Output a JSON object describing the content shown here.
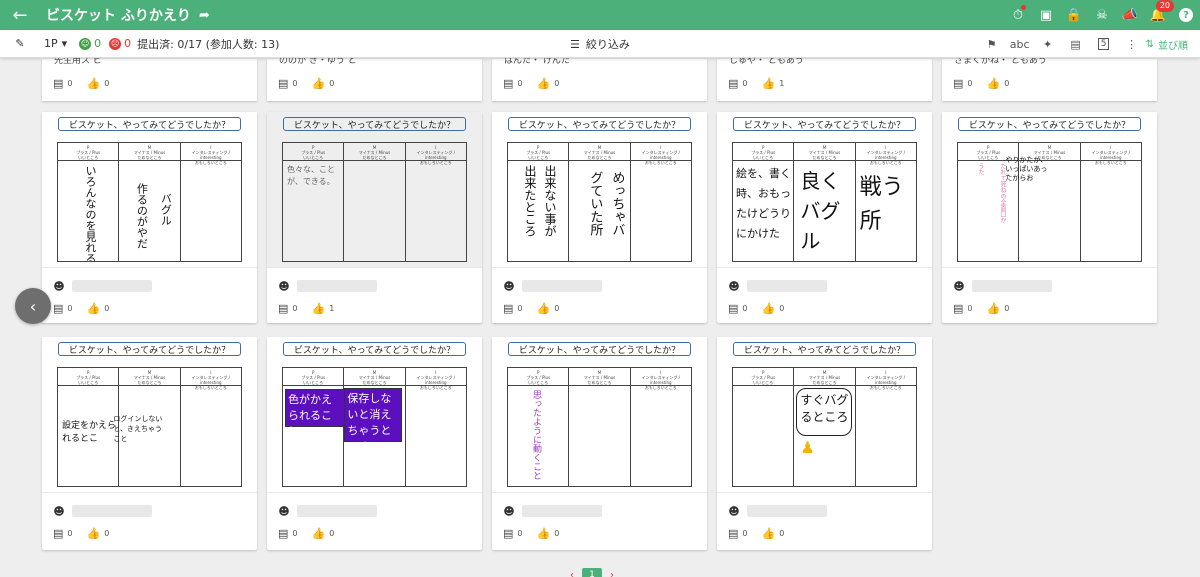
{
  "header": {
    "title": "ビスケット ふりかえり",
    "notification_count": "20",
    "help_label": "?"
  },
  "toolbar": {
    "page": "1P",
    "happy_count": "0",
    "sad_count": "0",
    "submitted": "提出済: 0/17 (参加人数: 13)",
    "filter_label": "絞り込み",
    "sort_label": "並び順",
    "num5": "5"
  },
  "top_strip": [
    {
      "name": "先生用ス ビ",
      "comments": "0",
      "likes": "0"
    },
    {
      "name": "ののか き・ゆう と",
      "comments": "0",
      "likes": "0"
    },
    {
      "name": "はんた・ けんた",
      "comments": "0",
      "likes": "0"
    },
    {
      "name": "しゅや・ ともあう",
      "comments": "0",
      "likes": "1"
    },
    {
      "name": "さまくかね・ ともあう",
      "comments": "0",
      "likes": "0"
    }
  ],
  "question": "ビスケット、やってみてどうでしたか？",
  "col_headers": {
    "p": "P\nプラス / Plus\nいいところ",
    "m": "M\nマイナス / Minus\nだめなところ",
    "i": "I\nインタレスティング / interesting\nおもしろいところ"
  },
  "row1": [
    {
      "p": "いろんなのを見れる",
      "m1": "作るのがやだ",
      "m2": "バグル",
      "i": "",
      "comments": "0",
      "likes": "0"
    },
    {
      "p": "色々な、ことが、できる。",
      "m": "",
      "i": "",
      "comments": "0",
      "likes": "1"
    },
    {
      "p1": "出来ない事が",
      "p2": "出来たところ",
      "m1": "めっちゃバ",
      "m2": "グていた所",
      "i": "",
      "comments": "0",
      "likes": "0"
    },
    {
      "p": "絵を、書く時、おもったけどうりにかけた",
      "m": "良くバグル",
      "i": "戦う所",
      "comments": "0",
      "likes": "0"
    },
    {
      "p": "",
      "m": "やりかたか、いっぱいあったからお",
      "p_pink1": "たれて死ねの全面口か",
      "p_pink2": "うた",
      "comments": "0",
      "likes": "0"
    }
  ],
  "row2": [
    {
      "p": "設定をかえられるとこ",
      "m": "ログインしないと、きえちゃうこと",
      "i": "",
      "comments": "0",
      "likes": "0"
    },
    {
      "p": "色がかえられること",
      "m": "保存しないと消えちゃうところ",
      "i": "",
      "comments": "0",
      "likes": "0"
    },
    {
      "p": "思ったように動くこと",
      "m": "",
      "i": "",
      "comments": "0",
      "likes": "0"
    },
    {
      "p": "",
      "m": "すぐバグるところ",
      "i": "",
      "comments": "0",
      "likes": "0"
    }
  ],
  "pagination": {
    "current": "1"
  },
  "colors": {
    "brand": "#4bb07a",
    "purple": "#5b0fbf",
    "badge": "#e53935"
  }
}
